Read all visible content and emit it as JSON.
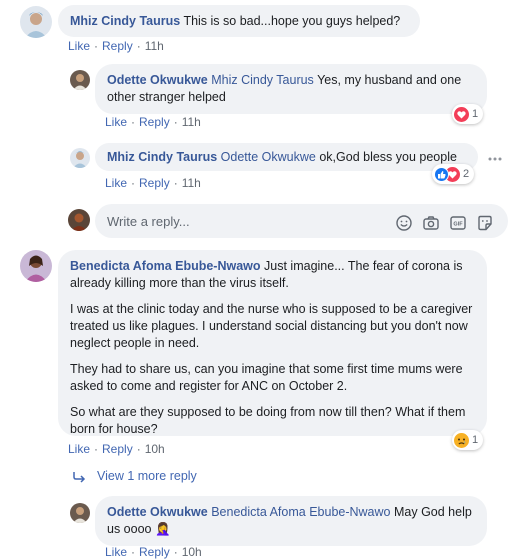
{
  "comment1": {
    "author": "Mhiz Cindy Taurus",
    "text": "This is so bad...hope you guys helped?",
    "like": "Like",
    "reply": "Reply",
    "time": "11h"
  },
  "reply1": {
    "author": "Odette Okwukwe",
    "mention": "Mhiz Cindy Taurus",
    "text": "Yes, my husband and one other stranger helped",
    "like": "Like",
    "reply": "Reply",
    "time": "11h",
    "reaction_count": "1"
  },
  "reply2": {
    "author": "Mhiz Cindy Taurus",
    "mention": "Odette Okwukwe",
    "text": "ok,God bless you people",
    "like": "Like",
    "reply": "Reply",
    "time": "11h",
    "reaction_count": "2",
    "more_icon": "more-horizontal-icon"
  },
  "reply_box": {
    "placeholder": "Write a reply...",
    "icons": [
      "emoji-icon",
      "camera-icon",
      "gif-icon",
      "sticker-icon"
    ]
  },
  "comment2": {
    "author": "Benedicta Afoma Ebube-Nwawo",
    "text_first": "Just imagine... The fear of corona is already killing more than the virus itself.",
    "paragraphs": [
      "I was at the clinic today and the nurse who is supposed to be a caregiver treated us like plagues. I understand social distancing but you don't now neglect people in need.",
      "They had to share us, can you imagine that some first time mums were asked to come and register for ANC on October 2.",
      "So what are they supposed to be doing from now till then? What if them born for house?"
    ],
    "like": "Like",
    "reply": "Reply",
    "time": "10h",
    "reaction_count": "1"
  },
  "view_more": "View 1 more reply",
  "reply3": {
    "author": "Odette Okwukwe",
    "mention": "Benedicta Afoma Ebube-Nwawo",
    "text": "May God help us oooo 🤦‍♀️",
    "like": "Like",
    "reply": "Reply",
    "time": "10h"
  },
  "colors": {
    "name": "#385898",
    "link": "#4267b2",
    "bubble": "#f0f2f5",
    "love": "#f33e58",
    "like": "#1877f2",
    "sad": "#f7b125"
  }
}
